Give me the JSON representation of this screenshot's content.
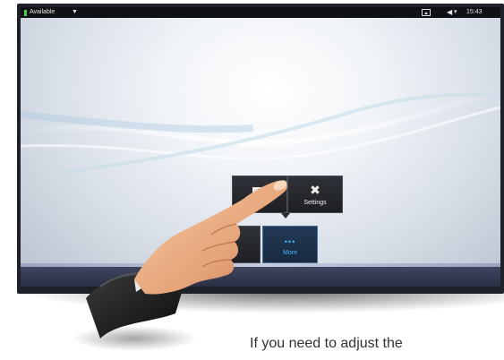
{
  "status_bar": {
    "availability": "Available",
    "time": "15:43",
    "icons": [
      "caret-down-icon",
      "picture-icon",
      "speaker-icon",
      "caret-down-icon"
    ]
  },
  "menu": {
    "tiles": [
      {
        "label": "",
        "icon": "video-icon"
      },
      {
        "label": "Settings",
        "icon": "wrench-screwdriver-icon"
      },
      {
        "label": "",
        "icon": "partial-tile-icon"
      },
      {
        "label": "More",
        "icon": "more-dots-icon"
      }
    ]
  },
  "caption": "If you need to adjust the",
  "colors": {
    "availability": "#44d04a",
    "accent": "#49b4ff",
    "tile_bg": "#2f3238"
  }
}
